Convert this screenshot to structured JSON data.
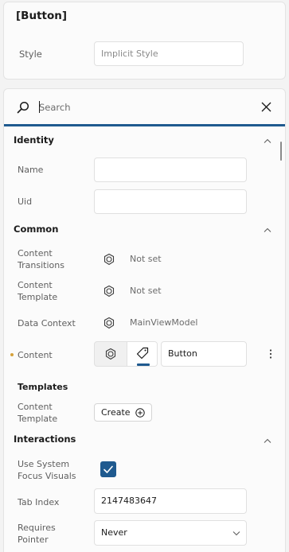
{
  "header": {
    "element_title": "[Button]",
    "style_label": "Style",
    "style_value": "Implicit Style"
  },
  "search": {
    "placeholder": "Search",
    "value": ""
  },
  "sections": {
    "identity": {
      "title": "Identity",
      "name_label": "Name",
      "name_value": "",
      "uid_label": "Uid",
      "uid_value": ""
    },
    "common": {
      "title": "Common",
      "content_transitions_label_1": "Content",
      "content_transitions_label_2": "Transitions",
      "content_transitions_value": "Not set",
      "content_template_label_1": "Content",
      "content_template_label_2": "Template",
      "content_template_value": "Not set",
      "data_context_label": "Data Context",
      "data_context_value": "MainViewModel",
      "content_label": "Content",
      "content_value": "Button"
    },
    "templates": {
      "title": "Templates",
      "content_template_label_1": "Content",
      "content_template_label_2": "Template",
      "create_label": "Create"
    },
    "interactions": {
      "title": "Interactions",
      "focus_visuals_label_1": "Use System",
      "focus_visuals_label_2": "Focus Visuals",
      "focus_visuals_checked": true,
      "tab_index_label": "Tab Index",
      "tab_index_value": "2147483647",
      "requires_pointer_label_1": "Requires",
      "requires_pointer_label_2": "Pointer",
      "requires_pointer_value": "Never"
    }
  },
  "colors": {
    "accent": "#1f5a8f",
    "modified_dot": "#d6a23b",
    "background": "#f3f3f3",
    "card": "#fbfbfb"
  },
  "icons": {
    "search": "search-icon",
    "close": "close-icon",
    "collapse": "chevron-up-icon",
    "binding": "binding-icon",
    "tag": "tag-icon",
    "more": "kebab-icon",
    "add": "add-circle-icon",
    "check": "checkmark-icon",
    "dropdown": "chevron-down-icon"
  }
}
